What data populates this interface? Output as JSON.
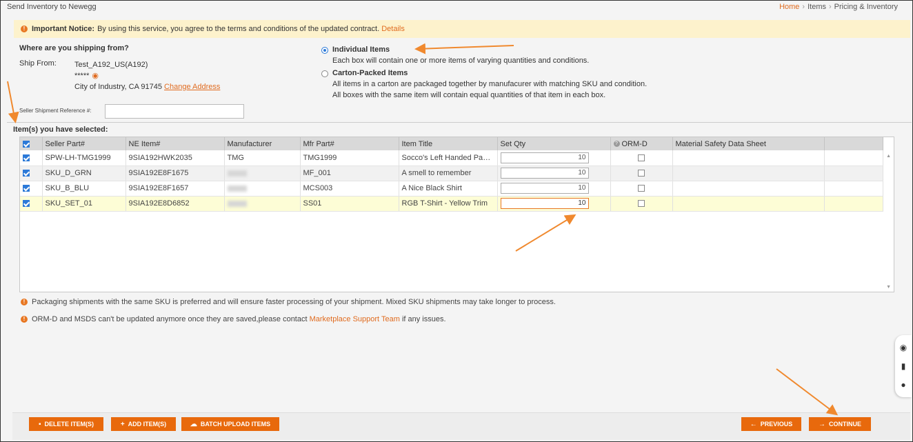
{
  "header": {
    "title": "Send Inventory to Newegg",
    "breadcrumb": [
      "Home",
      "Items",
      "Pricing & Inventory"
    ]
  },
  "notice": {
    "label": "Important Notice:",
    "text": "By using this service, you agree to the terms and conditions of the updated contract.",
    "link": "Details"
  },
  "shipping": {
    "question": "Where are you shipping from?",
    "ship_from_label": "Ship From:",
    "warehouse": "Test_A192_US(A192)",
    "masked": "*****",
    "address": "City of Industry, CA 91745",
    "change_link": "Change Address"
  },
  "packing": {
    "individual": {
      "title": "Individual Items",
      "desc": "Each box will contain one or more items of varying quantities and conditions.",
      "selected": true
    },
    "carton": {
      "title": "Carton-Packed Items",
      "desc1": "All items in a carton are packaged together by manufacurer with matching SKU and condition.",
      "desc2": "All boxes with the same item will contain equal quantities of that item in each box.",
      "selected": false
    }
  },
  "reference": {
    "label": "Seller Shipment Reference #:",
    "value": ""
  },
  "items": {
    "label": "Item(s) you have selected:",
    "columns": [
      "Seller Part#",
      "NE Item#",
      "Manufacturer",
      "Mfr Part#",
      "Item Title",
      "Set Qty",
      "ORM-D",
      "Material Safety Data Sheet"
    ],
    "rows": [
      {
        "seller_part": "SPW-LH-TMG1999",
        "ne_item": "9SIA192HWK2035",
        "manufacturer": "TMG",
        "mfr_part": "TMG1999",
        "title": "Socco's Left Handed Paper Towels",
        "qty": "10"
      },
      {
        "seller_part": "SKU_D_GRN",
        "ne_item": "9SIA192E8F1675",
        "manufacturer": "",
        "mfr_part": "MF_001",
        "title": "A smell to remember",
        "qty": "10"
      },
      {
        "seller_part": "SKU_B_BLU",
        "ne_item": "9SIA192E8F1657",
        "manufacturer": "",
        "mfr_part": "MCS003",
        "title": "A Nice Black Shirt",
        "qty": "10"
      },
      {
        "seller_part": "SKU_SET_01",
        "ne_item": "9SIA192E8D6852",
        "manufacturer": "",
        "mfr_part": "SS01",
        "title": "RGB T-Shirt - Yellow Trim",
        "qty": "10"
      }
    ]
  },
  "notes": {
    "note1": "Packaging shipments with the same SKU is preferred and will ensure faster processing of your shipment. Mixed SKU shipments may take longer to process.",
    "note2_pre": "ORM-D and MSDS can't be updated anymore once they are saved,please contact",
    "note2_link": "Marketplace Support Team",
    "note2_post": "if any issues."
  },
  "footer": {
    "delete": "DELETE ITEM(S)",
    "add": "ADD ITEM(S)",
    "batch": "BATCH UPLOAD ITEMS",
    "previous": "PREVIOUS",
    "continue": "CONTINUE"
  },
  "colors": {
    "accent": "#e8690c",
    "notice_bg": "#fdf2cc",
    "selected_row": "#fdfdd6",
    "annotation_arrow": "#f0892e"
  }
}
